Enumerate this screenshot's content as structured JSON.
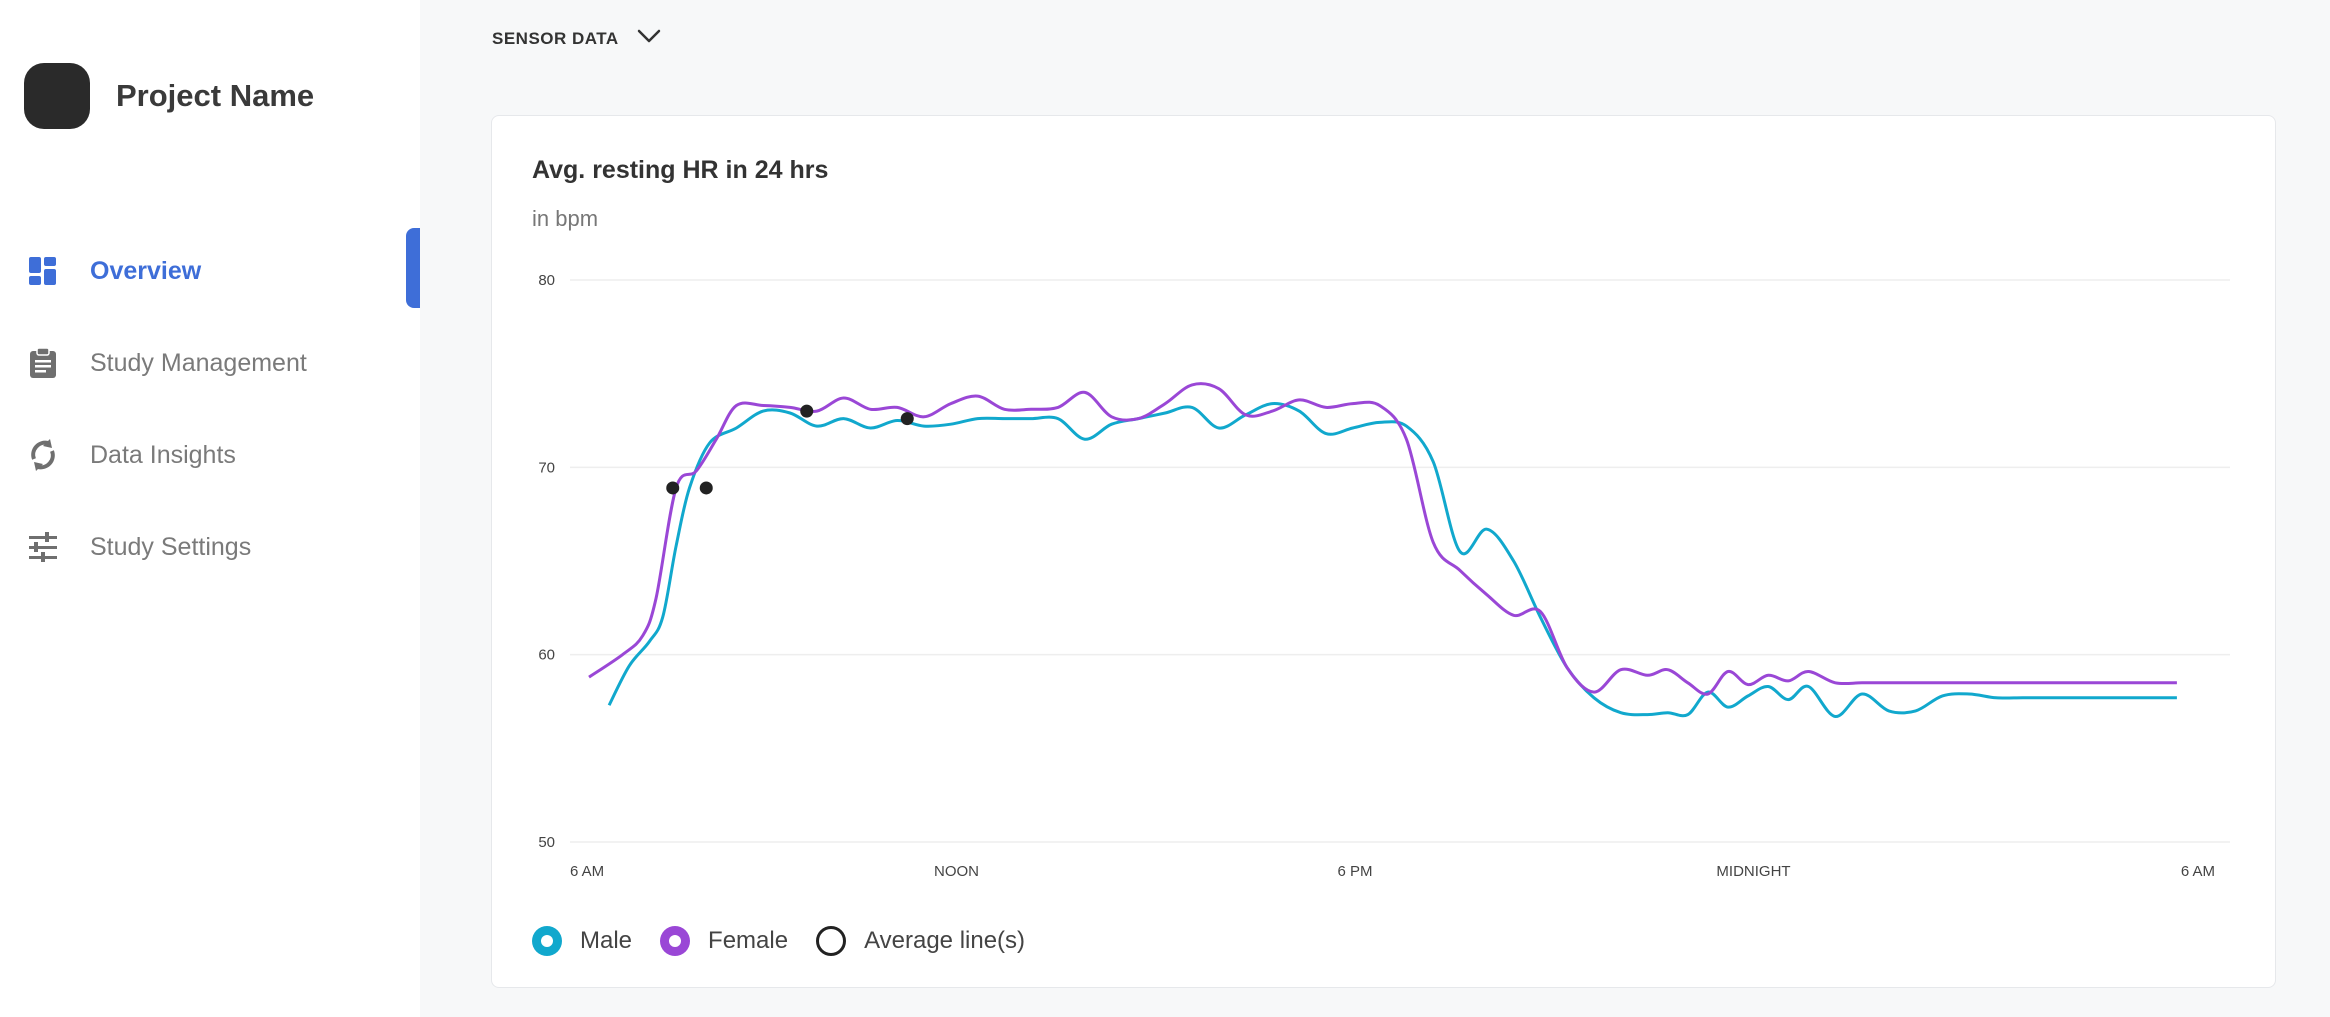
{
  "sidebar": {
    "project_name": "Project Name",
    "items": [
      {
        "label": "Overview",
        "icon": "dashboard-icon",
        "active": true
      },
      {
        "label": "Study Management",
        "icon": "clipboard-icon",
        "active": false
      },
      {
        "label": "Data Insights",
        "icon": "insights-icon",
        "active": false
      },
      {
        "label": "Study Settings",
        "icon": "sliders-icon",
        "active": false
      }
    ]
  },
  "header": {
    "section_title": "SENSOR DATA",
    "dropdown_icon": "chevron-down-icon"
  },
  "colors": {
    "accent": "#3e6ed8",
    "male": "#11a8cd",
    "female": "#9a47d6",
    "average": "#222222",
    "grid": "#eeeeee"
  },
  "chart_data": {
    "type": "line",
    "title": "Avg. resting HR in 24 hrs",
    "subtitle": "in bpm",
    "ylim": [
      50,
      80
    ],
    "yticks": [
      "80",
      "70",
      "60",
      "50"
    ],
    "xlim": [
      0,
      24
    ],
    "xticks": [
      {
        "x": 0,
        "label": "6 AM"
      },
      {
        "x": 6,
        "label": "NOON"
      },
      {
        "x": 12,
        "label": "6 PM"
      },
      {
        "x": 18,
        "label": "MIDNIGHT"
      },
      {
        "x": 24,
        "label": "6 AM"
      }
    ],
    "grid": true,
    "legend_position": "bottom-left",
    "series": [
      {
        "name": "Male",
        "color_key": "male",
        "x": [
          0.3,
          0.6,
          0.9,
          1.1,
          1.3,
          1.5,
          1.8,
          2.2,
          2.6,
          3.0,
          3.4,
          3.8,
          4.2,
          4.6,
          5.0,
          5.4,
          5.8,
          6.2,
          6.6,
          7.0,
          7.4,
          7.8,
          8.2,
          8.6,
          9.0,
          9.4,
          9.8,
          10.2,
          10.6,
          11.0,
          11.4,
          11.8,
          12.2,
          12.6,
          13.0,
          13.4,
          13.8,
          14.2,
          14.6,
          15.0,
          15.4,
          15.8,
          16.1,
          16.4,
          16.7,
          17.0,
          17.3,
          17.6,
          17.9,
          18.2,
          18.6,
          19.0,
          19.4,
          19.8,
          20.2,
          20.6,
          21.0,
          21.4,
          21.8,
          22.2,
          22.6,
          23.0,
          23.4,
          23.7
        ],
        "values": [
          57.3,
          59.4,
          60.7,
          62.0,
          65.8,
          68.9,
          71.3,
          72.1,
          73.0,
          72.9,
          72.2,
          72.6,
          72.1,
          72.5,
          72.2,
          72.3,
          72.6,
          72.6,
          72.6,
          72.6,
          71.5,
          72.3,
          72.6,
          72.9,
          73.2,
          72.1,
          72.8,
          73.4,
          73.0,
          71.8,
          72.1,
          72.4,
          72.2,
          70.3,
          65.5,
          66.7,
          65.0,
          62.0,
          59.3,
          57.7,
          56.9,
          56.8,
          56.9,
          56.8,
          58.0,
          57.2,
          57.8,
          58.3,
          57.6,
          58.3,
          56.7,
          57.9,
          57.0,
          57.0,
          57.8,
          57.9,
          57.7,
          57.7,
          57.7,
          57.7,
          57.7,
          57.7,
          57.7,
          57.7
        ]
      },
      {
        "name": "Female",
        "color_key": "female",
        "x": [
          0.0,
          0.5,
          0.8,
          1.0,
          1.3,
          1.6,
          1.9,
          2.2,
          2.6,
          3.0,
          3.4,
          3.8,
          4.2,
          4.6,
          5.0,
          5.4,
          5.8,
          6.2,
          6.6,
          7.0,
          7.4,
          7.8,
          8.2,
          8.6,
          9.0,
          9.4,
          9.8,
          10.2,
          10.6,
          11.0,
          11.4,
          11.8,
          12.2,
          12.6,
          13.0,
          13.4,
          13.8,
          14.2,
          14.6,
          15.0,
          15.4,
          15.8,
          16.1,
          16.4,
          16.7,
          17.0,
          17.3,
          17.6,
          17.9,
          18.2,
          18.6,
          19.0,
          19.4,
          19.8,
          20.2,
          20.6,
          21.0,
          21.4,
          21.8,
          22.2,
          22.6,
          23.0,
          23.4,
          23.7
        ],
        "values": [
          58.8,
          60.0,
          61.0,
          63.0,
          68.9,
          69.8,
          71.5,
          73.3,
          73.3,
          73.2,
          73.0,
          73.7,
          73.1,
          73.2,
          72.7,
          73.4,
          73.8,
          73.1,
          73.1,
          73.2,
          74.0,
          72.7,
          72.6,
          73.4,
          74.4,
          74.2,
          72.8,
          73.0,
          73.6,
          73.2,
          73.4,
          73.3,
          71.5,
          66.0,
          64.5,
          63.2,
          62.1,
          62.3,
          59.3,
          58.0,
          59.2,
          58.9,
          59.2,
          58.5,
          57.9,
          59.1,
          58.4,
          58.9,
          58.6,
          59.1,
          58.5,
          58.5,
          58.5,
          58.5,
          58.5,
          58.5,
          58.5,
          58.5,
          58.5,
          58.5,
          58.5,
          58.5,
          58.5,
          58.5
        ]
      },
      {
        "name": "Average line(s)",
        "color_key": "average",
        "points": [
          {
            "x": 1.25,
            "y": 68.9
          },
          {
            "x": 1.75,
            "y": 68.9
          },
          {
            "x": 3.25,
            "y": 73.0
          },
          {
            "x": 4.75,
            "y": 72.6
          }
        ]
      }
    ],
    "legend": [
      {
        "label": "Male",
        "color_key": "male",
        "selected": true
      },
      {
        "label": "Female",
        "color_key": "female",
        "selected": true
      },
      {
        "label": "Average line(s)",
        "color_key": "average",
        "selected": false
      }
    ]
  }
}
